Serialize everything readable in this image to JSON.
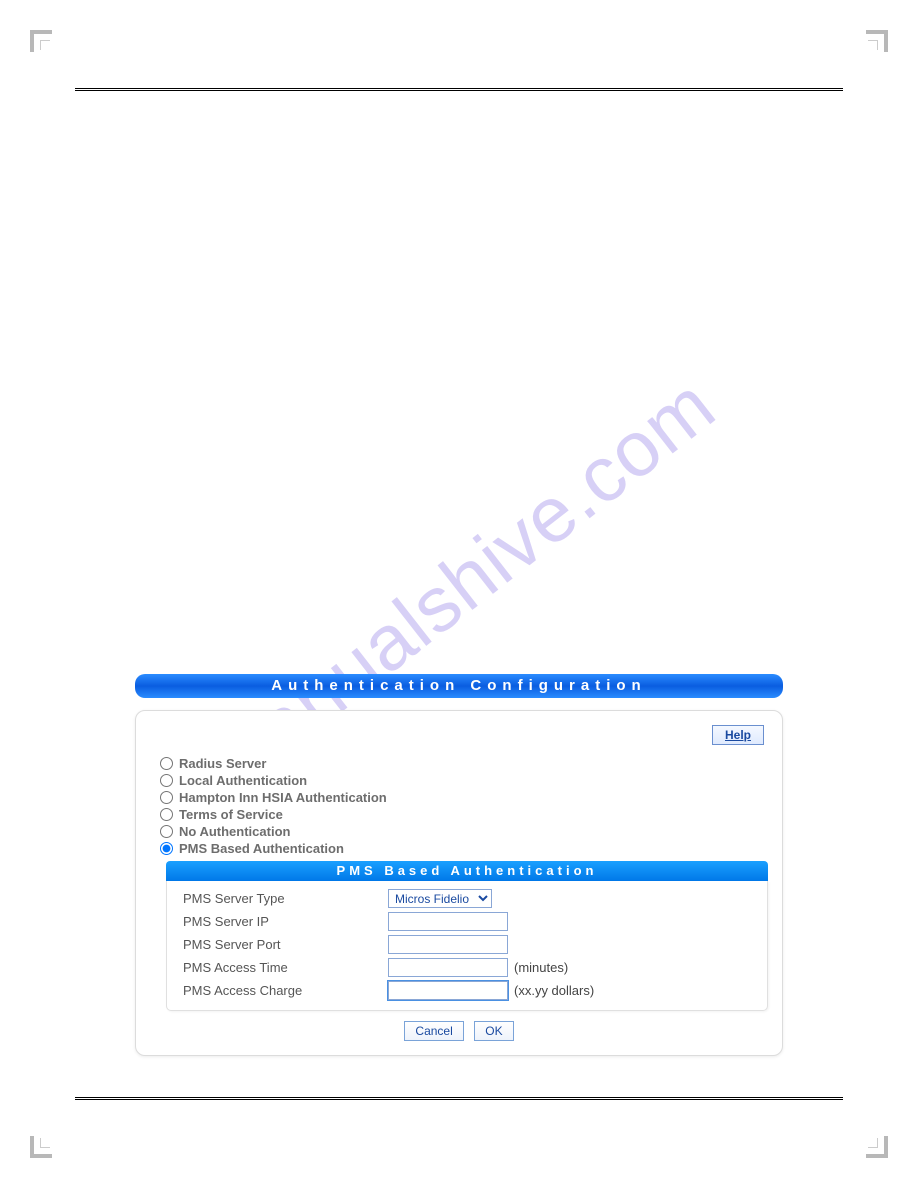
{
  "watermark": "manualshive.com",
  "panel": {
    "title": "Authentication Configuration",
    "help_label": "Help",
    "radios": [
      {
        "label": "Radius Server",
        "checked": false
      },
      {
        "label": "Local Authentication",
        "checked": false
      },
      {
        "label": "Hampton Inn HSIA Authentication",
        "checked": false
      },
      {
        "label": "Terms of Service",
        "checked": false
      },
      {
        "label": "No Authentication",
        "checked": false
      },
      {
        "label": "PMS Based Authentication",
        "checked": true
      }
    ],
    "sub_title": "PMS Based Authentication",
    "fields": {
      "server_type": {
        "label": "PMS Server Type",
        "value": "Micros Fidelio"
      },
      "server_ip": {
        "label": "PMS Server IP",
        "value": ""
      },
      "server_port": {
        "label": "PMS Server Port",
        "value": ""
      },
      "access_time": {
        "label": "PMS Access Time",
        "value": "",
        "hint": "(minutes)"
      },
      "access_charge": {
        "label": "PMS Access Charge",
        "value": "",
        "hint": "(xx.yy dollars)"
      }
    },
    "buttons": {
      "cancel": "Cancel",
      "ok": "OK"
    }
  }
}
